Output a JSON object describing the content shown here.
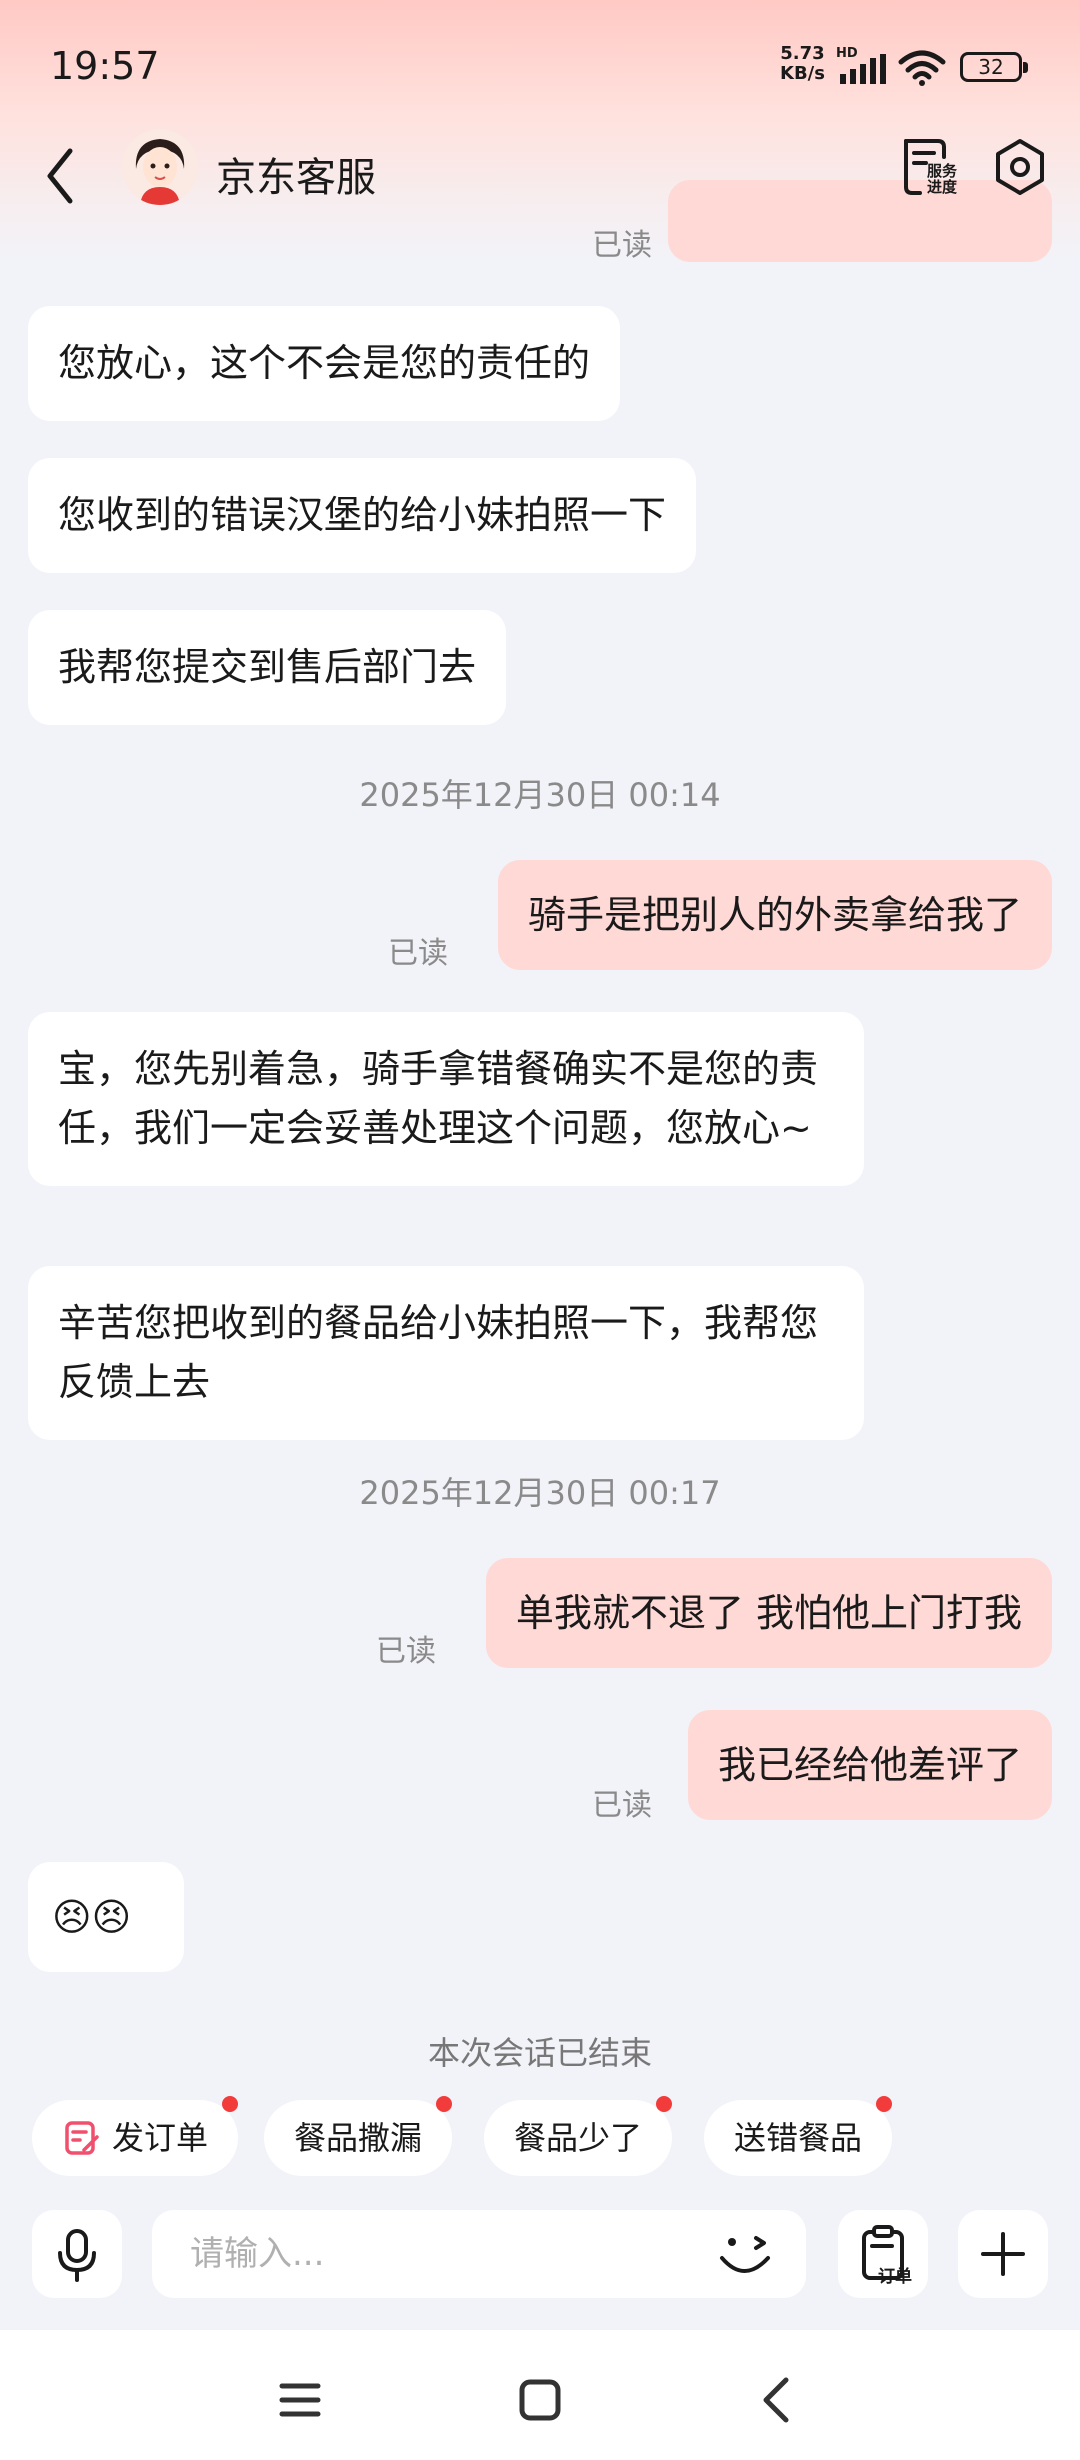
{
  "status_bar": {
    "time": "19:57",
    "speed_value": "5.73",
    "speed_unit": "KB/s",
    "network_badge": "HD",
    "battery": "32"
  },
  "header": {
    "title": "京东客服",
    "service_progress_label": "服务进度",
    "icons": [
      "back-arrow-icon",
      "avatar",
      "service-progress-icon",
      "settings-hexagon-icon"
    ]
  },
  "messages": {
    "partial_read": "已读",
    "m1": "您放心，这个不会是您的责任的",
    "m2": "您收到的错误汉堡的给小妹拍照一下",
    "m3": "我帮您提交到售后部门去",
    "ts1": "2025年12月30日 00:14",
    "m4": "骑手是把别人的外卖拿给我了",
    "m4_read": "已读",
    "m5": "宝，您先别着急，骑手拿错餐确实不是您的责任，我们一定会妥善处理这个问题，您放心~",
    "m6": "辛苦您把收到的餐品给小妹拍照一下，我帮您反馈上去",
    "ts2": "2025年12月30日 00:17",
    "m7": "单我就不退了 我怕他上门打我",
    "m7_read": "已读",
    "m8": "我已经给他差评了",
    "m8_read": "已读",
    "m9": "😣😣"
  },
  "session_ended": "本次会话已结束",
  "quick_actions": [
    {
      "label": "发订单",
      "icon": "order-edit-icon"
    },
    {
      "label": "餐品撒漏"
    },
    {
      "label": "餐品少了"
    },
    {
      "label": "送错餐品"
    }
  ],
  "input": {
    "placeholder": "请输入...",
    "order_label": "订单"
  },
  "colors": {
    "outgoing_bubble": "#ffd9d6",
    "incoming_bubble": "#ffffff",
    "background": "#f2f3f8",
    "badge_dot": "#f23b3b",
    "order_icon_accent": "#f0506e"
  }
}
